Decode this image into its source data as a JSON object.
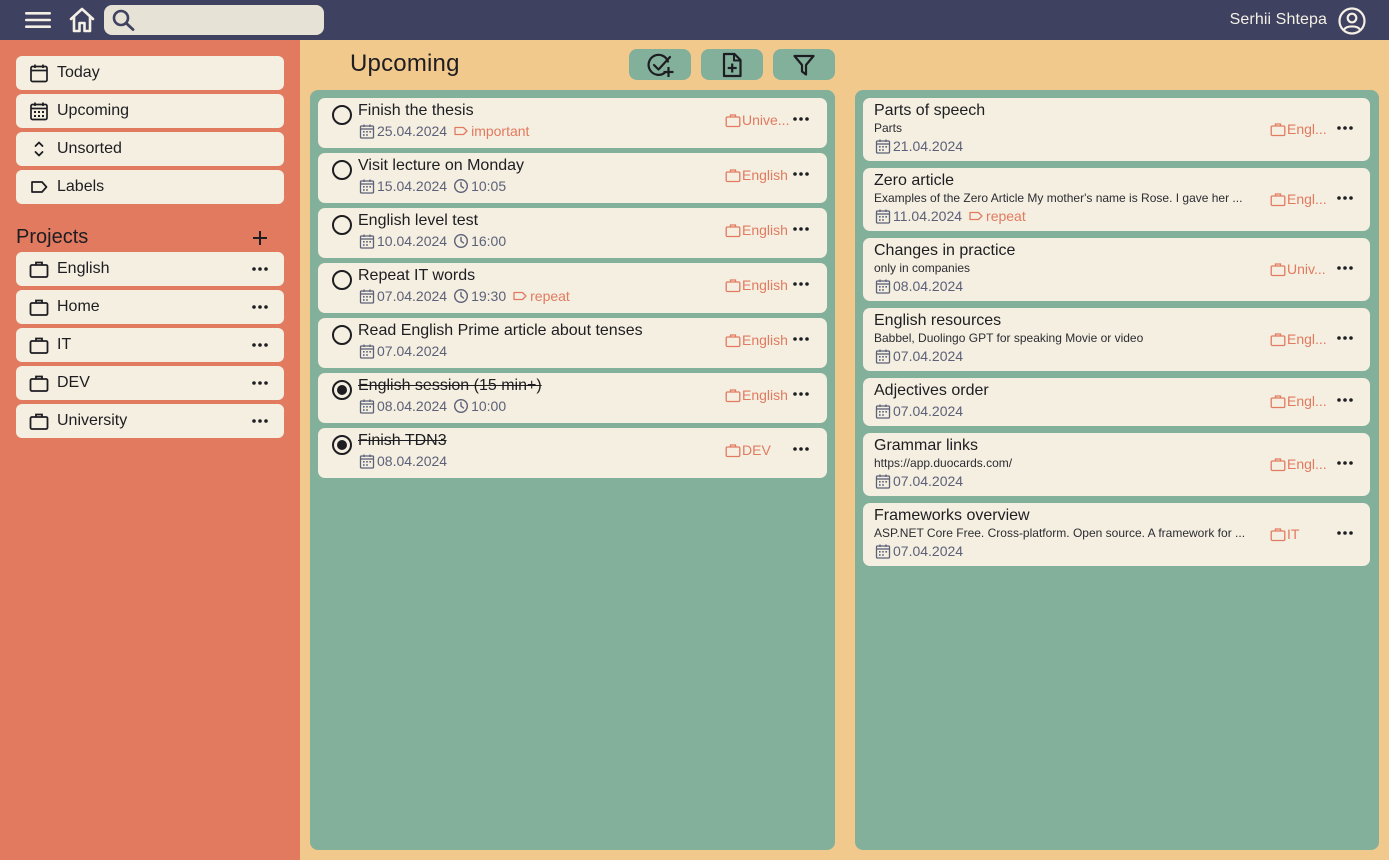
{
  "topbar": {
    "search_placeholder": "",
    "user_name": "Serhii Shtepa"
  },
  "sidebar": {
    "nav": [
      {
        "label": "Today",
        "icon": "calendar-icon"
      },
      {
        "label": "Upcoming",
        "icon": "calendar-grid-icon"
      },
      {
        "label": "Unsorted",
        "icon": "chevrons-updown-icon"
      },
      {
        "label": "Labels",
        "icon": "label-icon"
      }
    ],
    "projects_title": "Projects",
    "projects": [
      {
        "label": "English"
      },
      {
        "label": "Home"
      },
      {
        "label": "IT"
      },
      {
        "label": "DEV"
      },
      {
        "label": "University"
      }
    ]
  },
  "main": {
    "title": "Upcoming",
    "toolbar": [
      "add-task-icon",
      "add-note-icon",
      "filter-icon"
    ]
  },
  "tasks": [
    {
      "title": "Finish the thesis",
      "date": "25.04.2024",
      "time": "",
      "label": "important",
      "project": "Unive...",
      "done": false
    },
    {
      "title": "Visit lecture on Monday",
      "date": "15.04.2024",
      "time": "10:05",
      "label": "",
      "project": "English",
      "done": false
    },
    {
      "title": "English level test",
      "date": "10.04.2024",
      "time": "16:00",
      "label": "",
      "project": "English",
      "done": false
    },
    {
      "title": "Repeat IT words",
      "date": "07.04.2024",
      "time": "19:30",
      "label": "repeat",
      "project": "English",
      "done": false
    },
    {
      "title": "Read English Prime article about tenses",
      "date": "07.04.2024",
      "time": "",
      "label": "",
      "project": "English",
      "done": false
    },
    {
      "title": "English session (15 min+)",
      "date": "08.04.2024",
      "time": "10:00",
      "label": "",
      "project": "English",
      "done": true
    },
    {
      "title": "Finish TDN3",
      "date": "08.04.2024",
      "time": "",
      "label": "",
      "project": "DEV",
      "done": true
    }
  ],
  "notes": [
    {
      "title": "Parts of speech",
      "desc": "Parts",
      "date": "21.04.2024",
      "label": "",
      "project": "Engl..."
    },
    {
      "title": "Zero article",
      "desc": "Examples of the Zero Article My mother's name is Rose. I gave her ...",
      "date": "11.04.2024",
      "label": "repeat",
      "project": "Engl..."
    },
    {
      "title": "Changes in practice",
      "desc": "only in companies",
      "date": "08.04.2024",
      "label": "",
      "project": "Univ..."
    },
    {
      "title": "English resources",
      "desc": "Babbel, Duolingo GPT for speaking Movie or video",
      "date": "07.04.2024",
      "label": "",
      "project": "Engl..."
    },
    {
      "title": "Adjectives order",
      "desc": "",
      "date": "07.04.2024",
      "label": "",
      "project": "Engl..."
    },
    {
      "title": "Grammar links",
      "desc": "https://app.duocards.com/",
      "date": "07.04.2024",
      "label": "",
      "project": "Engl..."
    },
    {
      "title": "Frameworks overview",
      "desc": "ASP.NET Core Free. Cross-platform. Open source. A framework for ...",
      "date": "07.04.2024",
      "label": "",
      "project": "IT"
    }
  ],
  "colors": {
    "topbar": "#3e415f",
    "sidebar": "#e27a60",
    "main_bg": "#f2c98d",
    "panel": "#82b09b",
    "card": "#f4efe0",
    "accent": "#e27a60",
    "meta_text": "#5d6079"
  }
}
